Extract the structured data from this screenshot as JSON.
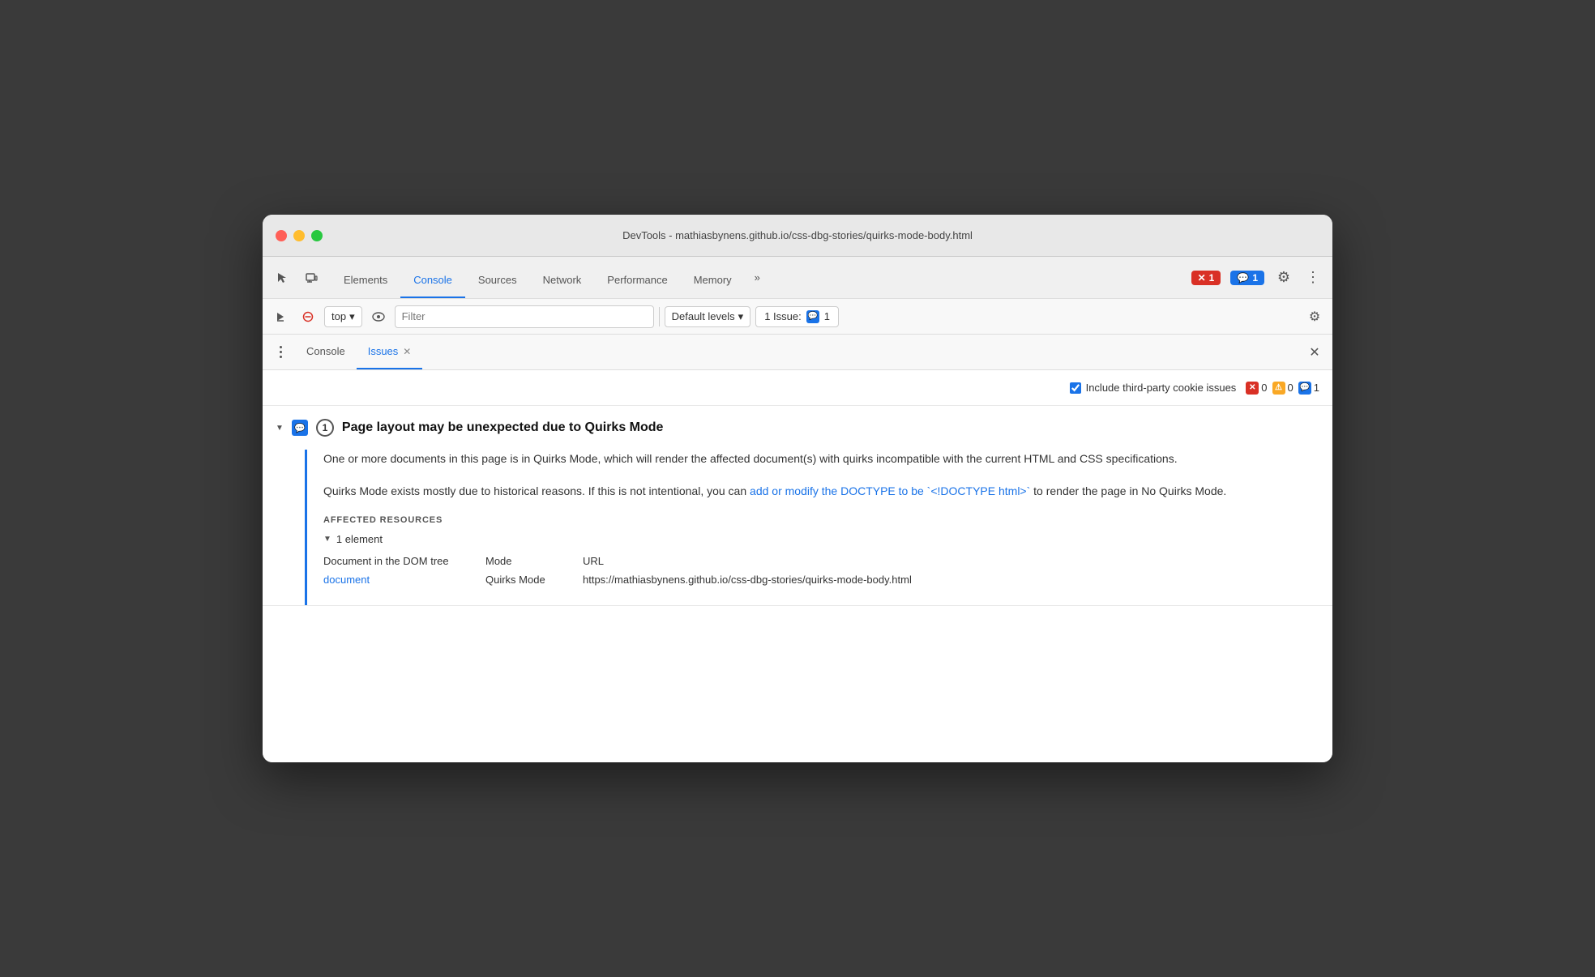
{
  "window": {
    "title": "DevTools - mathiasbynens.github.io/css-dbg-stories/quirks-mode-body.html"
  },
  "tabs": {
    "items": [
      {
        "label": "Elements",
        "active": false
      },
      {
        "label": "Console",
        "active": true
      },
      {
        "label": "Sources",
        "active": false
      },
      {
        "label": "Network",
        "active": false
      },
      {
        "label": "Performance",
        "active": false
      },
      {
        "label": "Memory",
        "active": false
      }
    ],
    "more_label": "»"
  },
  "toolbar": {
    "error_count": "1",
    "info_count": "1",
    "gear_label": "⚙",
    "more_label": "⋮"
  },
  "console_toolbar": {
    "context": "top",
    "filter_placeholder": "Filter",
    "levels_label": "Default levels",
    "issues_label": "1 Issue:",
    "issues_count": "1"
  },
  "panel_tabs": {
    "console_label": "Console",
    "issues_label": "Issues"
  },
  "issues_filter": {
    "cookie_label": "Include third-party cookie issues",
    "error_count": "0",
    "warning_count": "0",
    "info_count": "1"
  },
  "issue": {
    "title": "Page layout may be unexpected due to Quirks Mode",
    "count": "1",
    "description_1": "One or more documents in this page is in Quirks Mode, which will render the affected document(s) with quirks incompatible with the current HTML and CSS specifications.",
    "description_2_before": "Quirks Mode exists mostly due to historical reasons. If this is not intentional, you can ",
    "description_2_link": "add or modify the DOCTYPE to be `<!DOCTYPE html>`",
    "description_2_after": " to render the page in No Quirks Mode.",
    "affected_resources_label": "AFFECTED RESOURCES",
    "element_count_label": "1 element",
    "col_document": "Document in the DOM tree",
    "col_mode": "Mode",
    "col_url": "URL",
    "row_document_link": "document",
    "row_mode": "Quirks Mode",
    "row_url": "https://mathiasbynens.github.io/css-dbg-stories/quirks-mode-body.html"
  }
}
